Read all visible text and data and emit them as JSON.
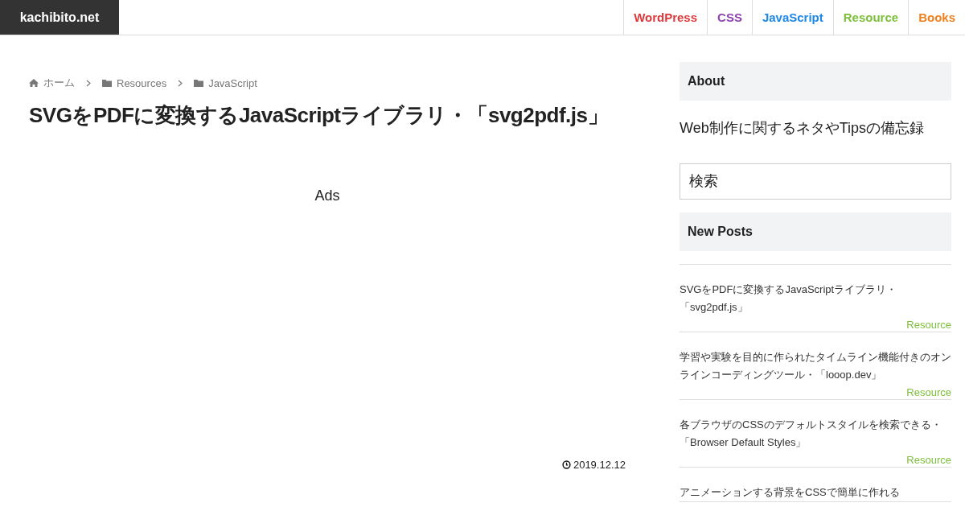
{
  "site_title": "kachibito.net",
  "nav": [
    {
      "label": "WordPress",
      "color": "#dd3b3b"
    },
    {
      "label": "CSS",
      "color": "#8e44ad"
    },
    {
      "label": "JavaScript",
      "color": "#1e88e5"
    },
    {
      "label": "Resource",
      "color": "#7cbf3a"
    },
    {
      "label": "Books",
      "color": "#f0801e"
    }
  ],
  "breadcrumbs": [
    {
      "kind": "home",
      "label": "ホーム"
    },
    {
      "kind": "folder",
      "label": "Resources"
    },
    {
      "kind": "folder",
      "label": "JavaScript"
    }
  ],
  "article": {
    "title": "SVGをPDFに変換するJavaScriptライブラリ・「svg2pdf.js」",
    "ads_label": "Ads",
    "date": "2019.12.12"
  },
  "sidebar": {
    "about_heading": "About",
    "about_text": "Web制作に関するネタやTipsの備忘録",
    "search": {
      "placeholder": "検索"
    },
    "new_posts_heading": "New Posts",
    "posts": [
      {
        "title": "SVGをPDFに変換するJavaScriptライブラリ・「svg2pdf.js」",
        "category": "Resource"
      },
      {
        "title": "学習や実験を目的に作られたタイムライン機能付きのオンラインコーディングツール・「looop.dev」",
        "category": "Resource"
      },
      {
        "title": "各ブラウザのCSSのデフォルトスタイルを検索できる・「Browser Default Styles」",
        "category": "Resource"
      },
      {
        "title": "アニメーションする背景をCSSで簡単に作れる"
      }
    ]
  }
}
